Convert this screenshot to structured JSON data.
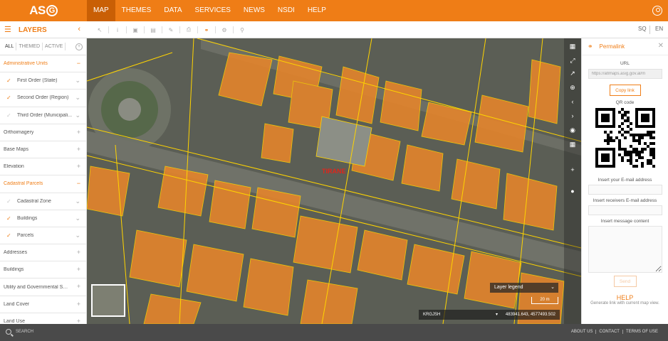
{
  "app": {
    "logo": "ASIG",
    "nav": [
      "MAP",
      "THEMES",
      "DATA",
      "SERVICES",
      "NEWS",
      "NSDI",
      "HELP"
    ],
    "active_nav": "MAP",
    "accent_color": "#ef7d16"
  },
  "toolbar": {
    "layers_title": "LAYERS",
    "langs": [
      "SQ",
      "EN"
    ],
    "tools": [
      "select-icon",
      "info-icon",
      "zoom-box-icon",
      "measure-icon",
      "edit-icon",
      "print-icon",
      "link-icon",
      "settings-icon",
      "search-icon"
    ]
  },
  "layers": {
    "tabs": [
      "ALL",
      "THEMED",
      "ACTIVE"
    ],
    "items": [
      {
        "label": "Administrative Units",
        "state": "expanded"
      },
      {
        "label": "First Order (State)",
        "sub": true,
        "checked": true
      },
      {
        "label": "Second Order (Region)",
        "sub": true,
        "checked": true
      },
      {
        "label": "Third Order (Municipali...",
        "sub": true,
        "checked": false
      },
      {
        "label": "Orthoimagery",
        "state": "collapsed"
      },
      {
        "label": "Base Maps",
        "state": "collapsed"
      },
      {
        "label": "Elevation",
        "state": "collapsed"
      },
      {
        "label": "Cadastral Parcels",
        "state": "expanded"
      },
      {
        "label": "Cadastral Zone",
        "sub": true,
        "checked": false
      },
      {
        "label": "Buildings",
        "sub": true,
        "checked": true
      },
      {
        "label": "Parcels",
        "sub": true,
        "checked": true
      },
      {
        "label": "Addresses",
        "state": "collapsed"
      },
      {
        "label": "Buildings",
        "state": "collapsed"
      },
      {
        "label": "Utility and Governmental Se...",
        "state": "collapsed"
      },
      {
        "label": "Land Cover",
        "state": "collapsed"
      },
      {
        "label": "Land Use",
        "state": "collapsed"
      }
    ]
  },
  "map": {
    "place_label": "TIRANE",
    "legend_label": "Layer legend",
    "scale_label": "20 m",
    "crs": "KRGJSH",
    "coordinates": "483941.643, 4577493.502"
  },
  "permalink": {
    "title": "Permalink",
    "url_label": "URL",
    "url_value": "https://atlmaps.asig.gov.al/m",
    "copy_button": "Copy link",
    "qr_label": "QR code",
    "email_label": "Insert your E-mail address",
    "receivers_label": "Insert receivers E-mail address",
    "message_label": "Insert message content",
    "send_button": "Send",
    "help_title": "HELP",
    "help_text": "Generate link with current map view."
  },
  "footer": {
    "search_label": "SEARCH",
    "links": [
      "ABOUT US",
      "CONTACT",
      "TERMS OF USE"
    ]
  }
}
